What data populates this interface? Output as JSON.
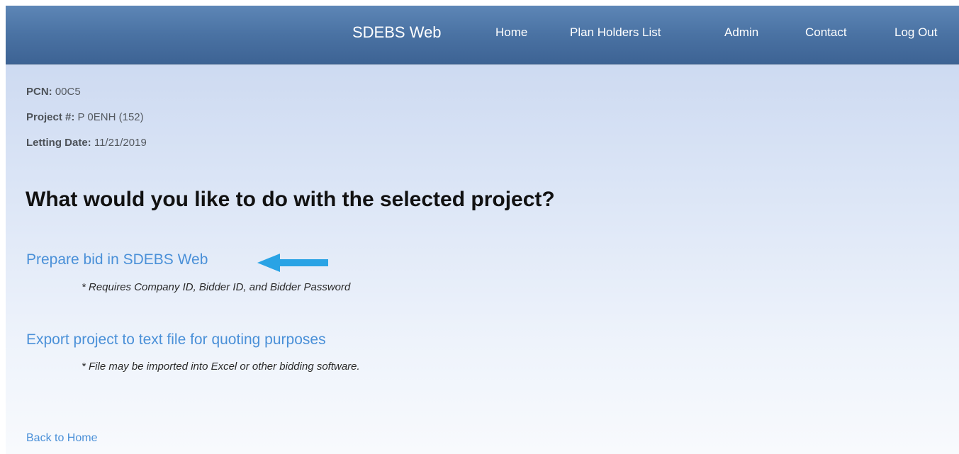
{
  "navbar": {
    "brand": "SDEBS Web",
    "links": [
      "Home",
      "Plan Holders List",
      "Admin",
      "Contact",
      "Log Out"
    ]
  },
  "project": {
    "pcn_label": "PCN:",
    "pcn_value": "00C5",
    "project_label": "Project #:",
    "project_value": "P 0ENH (152)",
    "letting_label": "Letting Date:",
    "letting_value": "11/21/2019"
  },
  "main": {
    "question": "What would you like to do with the selected project?",
    "prepare_link": "Prepare bid in SDEBS Web",
    "prepare_note": "* Requires Company ID, Bidder ID, and Bidder Password",
    "export_link": "Export project to text file for quoting purposes",
    "export_note": "* File may be imported into Excel or other bidding software.",
    "back_link": "Back to Home"
  },
  "colors": {
    "navbar": "#4a72a3",
    "link": "#4a90d8",
    "arrow": "#29a3e5"
  },
  "icons": {
    "annotation_arrow": "arrow-left-icon"
  }
}
